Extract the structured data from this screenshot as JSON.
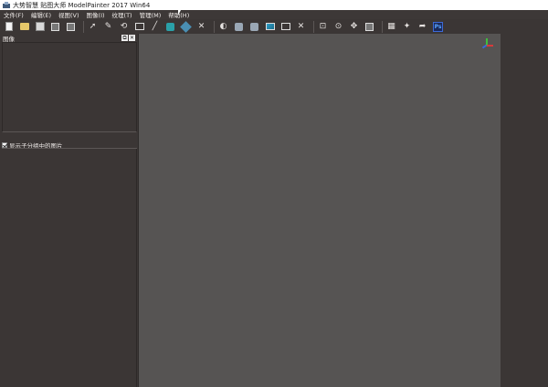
{
  "window": {
    "title": "大势智慧 贴图大师 ModelPainter 2017 Win64"
  },
  "menu": {
    "items": [
      {
        "label": "文件(F)"
      },
      {
        "label": "编辑(E)"
      },
      {
        "label": "视图(V)"
      },
      {
        "label": "图像(I)"
      },
      {
        "label": "纹理(T)"
      },
      {
        "label": "管理(M)"
      },
      {
        "label": "帮助(H)"
      }
    ]
  },
  "toolbar": {
    "tools": [
      {
        "name": "new-file-icon"
      },
      {
        "name": "open-folder-icon"
      },
      {
        "name": "save-icon"
      },
      {
        "name": "import-model-icon"
      },
      {
        "name": "import-image-icon"
      },
      {
        "name": "select-arrow-icon"
      },
      {
        "name": "lasso-icon"
      },
      {
        "name": "rotate-select-icon"
      },
      {
        "name": "rect-select-icon"
      },
      {
        "name": "line-icon"
      },
      {
        "name": "texture-icon"
      },
      {
        "name": "cube-icon"
      },
      {
        "name": "cross-icon"
      },
      {
        "name": "mirror-icon"
      },
      {
        "name": "sphere-icon"
      },
      {
        "name": "shade-icon"
      },
      {
        "name": "image-icon"
      },
      {
        "name": "frame-icon"
      },
      {
        "name": "close-x-icon"
      },
      {
        "name": "camera-front-icon"
      },
      {
        "name": "camera-fit-icon"
      },
      {
        "name": "move-icon"
      },
      {
        "name": "panel-icon"
      },
      {
        "name": "map-model-icon"
      },
      {
        "name": "auto-map-icon"
      },
      {
        "name": "export-icon"
      },
      {
        "name": "photoshop-icon"
      }
    ],
    "photoshop_label": "Ps"
  },
  "left_panel": {
    "title": "图像",
    "float_glyph": "⧉",
    "close_glyph": "✕",
    "show_child_label": "显示子分组中的图片"
  },
  "colors": {
    "viewport_bg": "#565453",
    "panel_bg": "#3b3635",
    "axis_x": "#d83a3a",
    "axis_y": "#3fbf3f",
    "axis_z": "#3a6ad8"
  }
}
